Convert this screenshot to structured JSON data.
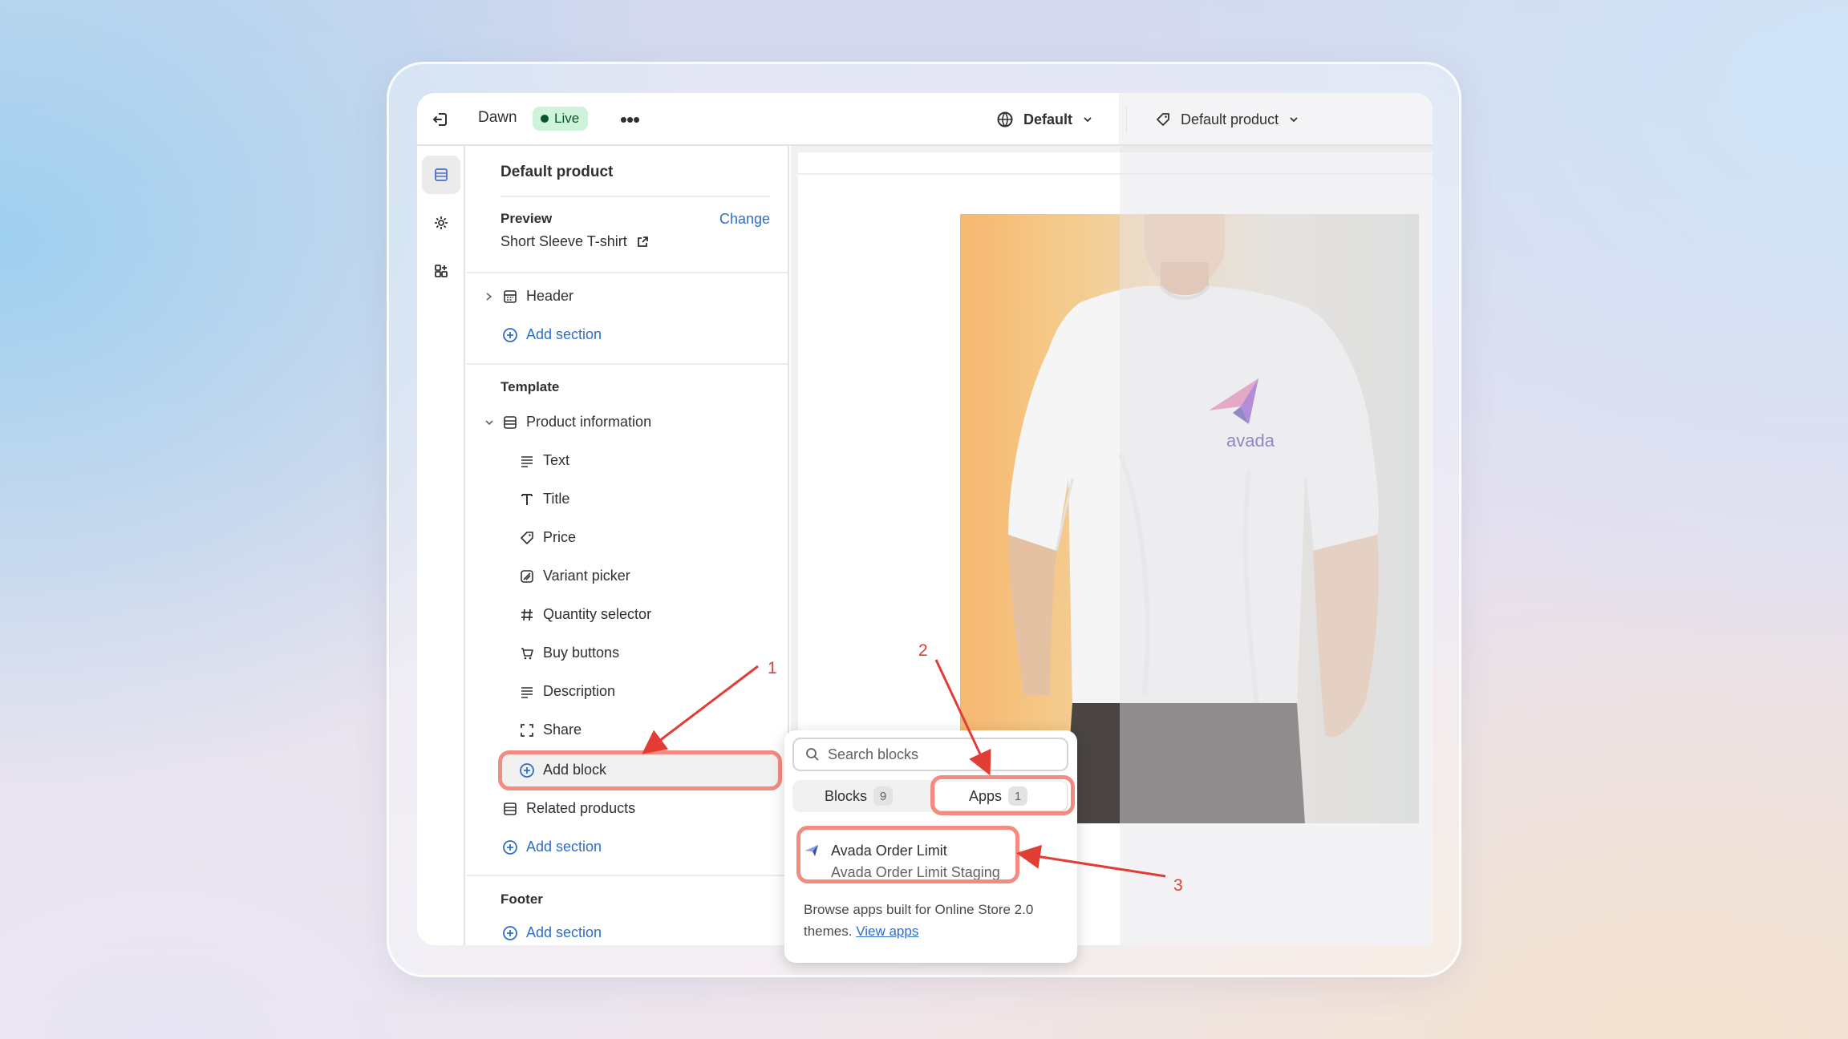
{
  "topbar": {
    "theme_name": "Dawn",
    "live_badge": "Live",
    "more_label": "•••",
    "language": "Default",
    "template": "Default product"
  },
  "sidebar": {
    "title": "Default product",
    "preview_label": "Preview",
    "change_link": "Change",
    "preview_product": "Short Sleeve T-shirt",
    "header_section": "Header",
    "add_section_1": "Add section",
    "template_label": "Template",
    "product_information": "Product information",
    "blocks": [
      {
        "label": "Text",
        "icon": "text-icon"
      },
      {
        "label": "Title",
        "icon": "title-icon"
      },
      {
        "label": "Price",
        "icon": "price-tag-icon"
      },
      {
        "label": "Variant picker",
        "icon": "variant-icon"
      },
      {
        "label": "Quantity selector",
        "icon": "hash-icon"
      },
      {
        "label": "Buy buttons",
        "icon": "cart-icon"
      },
      {
        "label": "Description",
        "icon": "text-icon"
      },
      {
        "label": "Share",
        "icon": "share-icon"
      }
    ],
    "add_block": "Add block",
    "related_products": "Related products",
    "add_section_2": "Add section",
    "footer_label": "Footer",
    "add_section_3": "Add section"
  },
  "preview": {
    "brand": "avada"
  },
  "popup": {
    "search_placeholder": "Search blocks",
    "tab_blocks": "Blocks",
    "tab_blocks_count": "9",
    "tab_apps": "Apps",
    "tab_apps_count": "1",
    "app_name": "Avada Order Limit",
    "app_sub": "Avada Order Limit Staging",
    "browse_text": "Browse apps built for Online Store 2.0 themes.",
    "view_apps": "View apps"
  },
  "annotations": {
    "step1": "1",
    "step2": "2",
    "step3": "3"
  },
  "colors": {
    "accent_link": "#2c6ecb",
    "highlight": "#f28b80",
    "arrow": "#e23d35",
    "live_bg": "#cdf3da"
  }
}
